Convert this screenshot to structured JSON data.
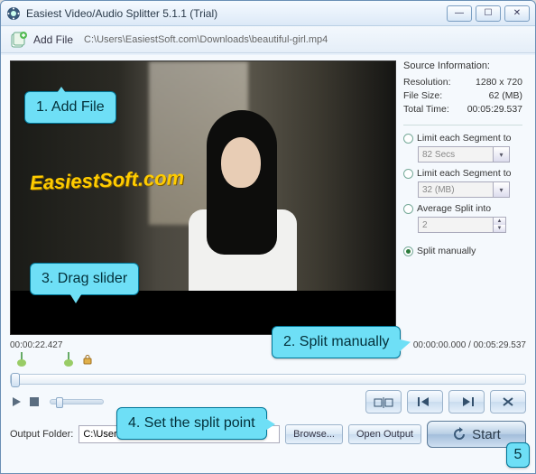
{
  "window": {
    "title": "Easiest Video/Audio Splitter 5.1.1 (Trial)"
  },
  "toolbar": {
    "add_file_label": "Add File",
    "filepath": "C:\\Users\\EasiestSoft.com\\Downloads\\beautiful-girl.mp4"
  },
  "source_info": {
    "header": "Source Information:",
    "resolution_label": "Resolution:",
    "resolution_value": "1280 x 720",
    "filesize_label": "File Size:",
    "filesize_value": "62 (MB)",
    "totaltime_label": "Total Time:",
    "totaltime_value": "00:05:29.537"
  },
  "split_opts": {
    "seg_time_label": "Limit each Segment to",
    "seg_time_value": "82 Secs",
    "seg_size_label": "Limit each Segment to",
    "seg_size_value": "32 (MB)",
    "avg_label": "Average Split into",
    "avg_value": "2",
    "manual_label": "Split manually"
  },
  "timeline": {
    "current": "00:00:22.427",
    "range": "00:00:00.000 / 00:05:29.537"
  },
  "output": {
    "label": "Output Folder:",
    "path": "C:\\Users\\EasiestSoft.com\\Videos\\",
    "browse": "Browse...",
    "open": "Open Output"
  },
  "start_label": "Start",
  "watermark": "EasiestSoft.com",
  "callouts": {
    "c1": "1. Add File",
    "c2": "2. Split manually",
    "c3": "3. Drag slider",
    "c4": "4. Set the split point",
    "c5": "5"
  },
  "icons": {
    "set_point": "set-split-point-icon",
    "prev": "prev-split-icon",
    "next": "next-split-icon",
    "cut": "cut-icon",
    "play": "play-icon",
    "stop": "stop-icon",
    "refresh": "refresh-icon"
  }
}
